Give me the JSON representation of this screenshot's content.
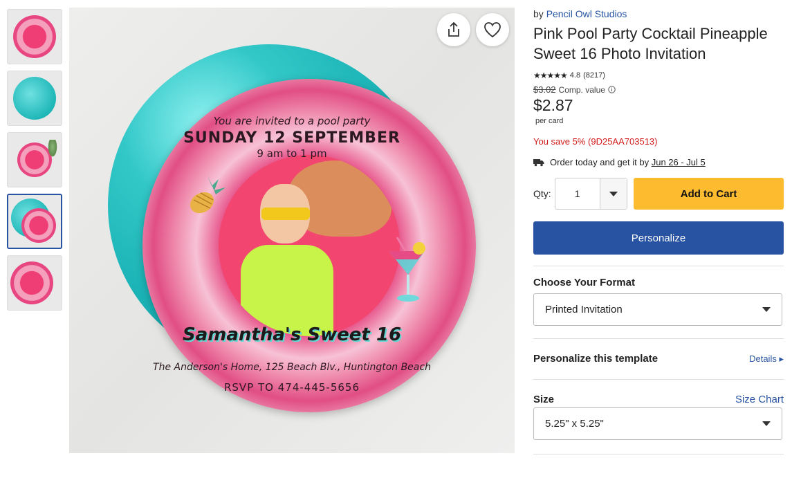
{
  "thumbnails": [
    {
      "label": "Thumbnail 1"
    },
    {
      "label": "Thumbnail 2"
    },
    {
      "label": "Thumbnail 3"
    },
    {
      "label": "Thumbnail 4"
    },
    {
      "label": "Thumbnail 5"
    }
  ],
  "card": {
    "line1": "You are invited to a pool party",
    "line2": "SUNDAY 12 SEPTEMBER",
    "line3": "9 am to 1 pm",
    "name": "Samantha's Sweet 16",
    "address": "The Anderson's Home, 125 Beach Blv., Huntington Beach",
    "rsvp": "RSVP TO 474-445-5656"
  },
  "product": {
    "by_prefix": "by",
    "seller": "Pencil Owl Studios",
    "title": "Pink Pool Party Cocktail Pineapple Sweet 16 Photo Invitation",
    "stars": "★★★★★",
    "rating": "4.8",
    "reviews": "(8217)",
    "comp_price": "$3.02",
    "comp_label": "Comp. value",
    "price": "$2.87",
    "per_unit": "per card",
    "savings": "You save 5% (9D25AA703513)",
    "ship_text": "Order today and get it by",
    "ship_dates": "Jun 26 - Jul 5"
  },
  "buy": {
    "qty_label": "Qty:",
    "qty_value": "1",
    "add_to_cart": "Add to Cart",
    "personalize": "Personalize"
  },
  "format": {
    "label": "Choose Your Format",
    "selected": "Printed Invitation"
  },
  "template": {
    "label": "Personalize this template",
    "details_link": "Details"
  },
  "size": {
    "label": "Size",
    "chart_link": "Size Chart",
    "selected": "5.25\" x 5.25\""
  },
  "colors": {
    "brand_blue": "#2753a2",
    "cart_yellow": "#fdbb30",
    "save_red": "#d21a1a"
  }
}
